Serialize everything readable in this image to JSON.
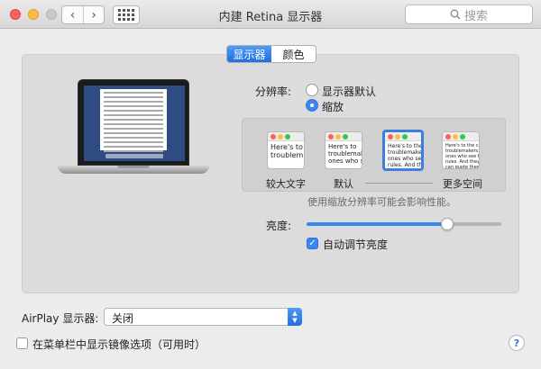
{
  "window": {
    "title": "内建 Retina 显示器",
    "search_placeholder": "搜索",
    "back_label": "‹",
    "forward_label": "›"
  },
  "tabs": [
    {
      "label": "显示器",
      "active": true
    },
    {
      "label": "颜色",
      "active": false
    }
  ],
  "resolution": {
    "label": "分辨率:",
    "options": [
      {
        "label": "显示器默认",
        "selected": false
      },
      {
        "label": "缩放",
        "selected": true
      }
    ]
  },
  "scale_options": [
    {
      "label": "较大文字",
      "preview": "Here's to\ntroublem",
      "selected": false
    },
    {
      "label": "默认",
      "preview": "Here's to\ntroublemak\nones who se",
      "selected": false
    },
    {
      "label": "",
      "preview": "Here's to the c\ntroublemakers.\nones who see t\nrules. And they",
      "selected": true
    },
    {
      "label": "更多空间",
      "preview": "Here's to the crazy one\ntroublemakers. The rou\nones who see things diff\nrules. And they have no\ncan quote them, disagre\nthem. About the only thi\nBecause they change th",
      "selected": false
    }
  ],
  "scale_note": "使用缩放分辨率可能会影响性能。",
  "brightness": {
    "label": "亮度:",
    "level": 0.72
  },
  "auto_brightness": {
    "label": "自动调节亮度",
    "checked": true
  },
  "airplay": {
    "label": "AirPlay 显示器:",
    "value": "关闭"
  },
  "mirror_option": {
    "label": "在菜单栏中显示镜像选项（可用时）",
    "checked": false
  },
  "help_label": "?",
  "colors": {
    "accent": "#3b86f0",
    "close": "#fc605c",
    "minimize": "#fdbc40"
  }
}
